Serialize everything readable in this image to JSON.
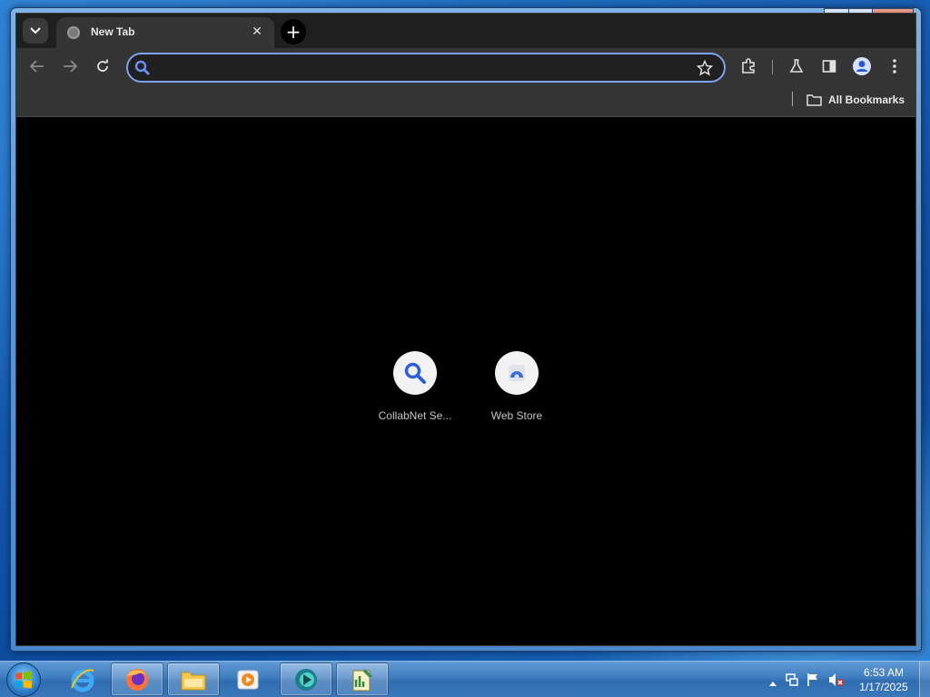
{
  "browser": {
    "tab": {
      "title": "New Tab",
      "close_glyph": "✕"
    },
    "new_tab_glyph": "+",
    "omnibox": {
      "value": "",
      "placeholder": ""
    },
    "bookmarks": {
      "all_label": "All Bookmarks"
    },
    "shortcuts": [
      {
        "label": "CollabNet Se...",
        "icon": "search-icon"
      },
      {
        "label": "Web Store",
        "icon": "web-store-icon"
      }
    ],
    "colors": {
      "accent": "#7ba3f0",
      "toolbar": "#353535",
      "tabstrip": "#1f1f1f"
    }
  },
  "window": {
    "minimize_glyph": "▬",
    "maximize_glyph": "□",
    "close_glyph": "✕"
  },
  "taskbar": {
    "apps": [
      "internet-explorer-icon",
      "firefox-icon",
      "file-explorer-icon",
      "media-player-icon",
      "chrome-like-app-icon",
      "notepad-chart-icon"
    ],
    "clock": {
      "time": "6:53 AM",
      "date": "1/17/2025"
    }
  }
}
